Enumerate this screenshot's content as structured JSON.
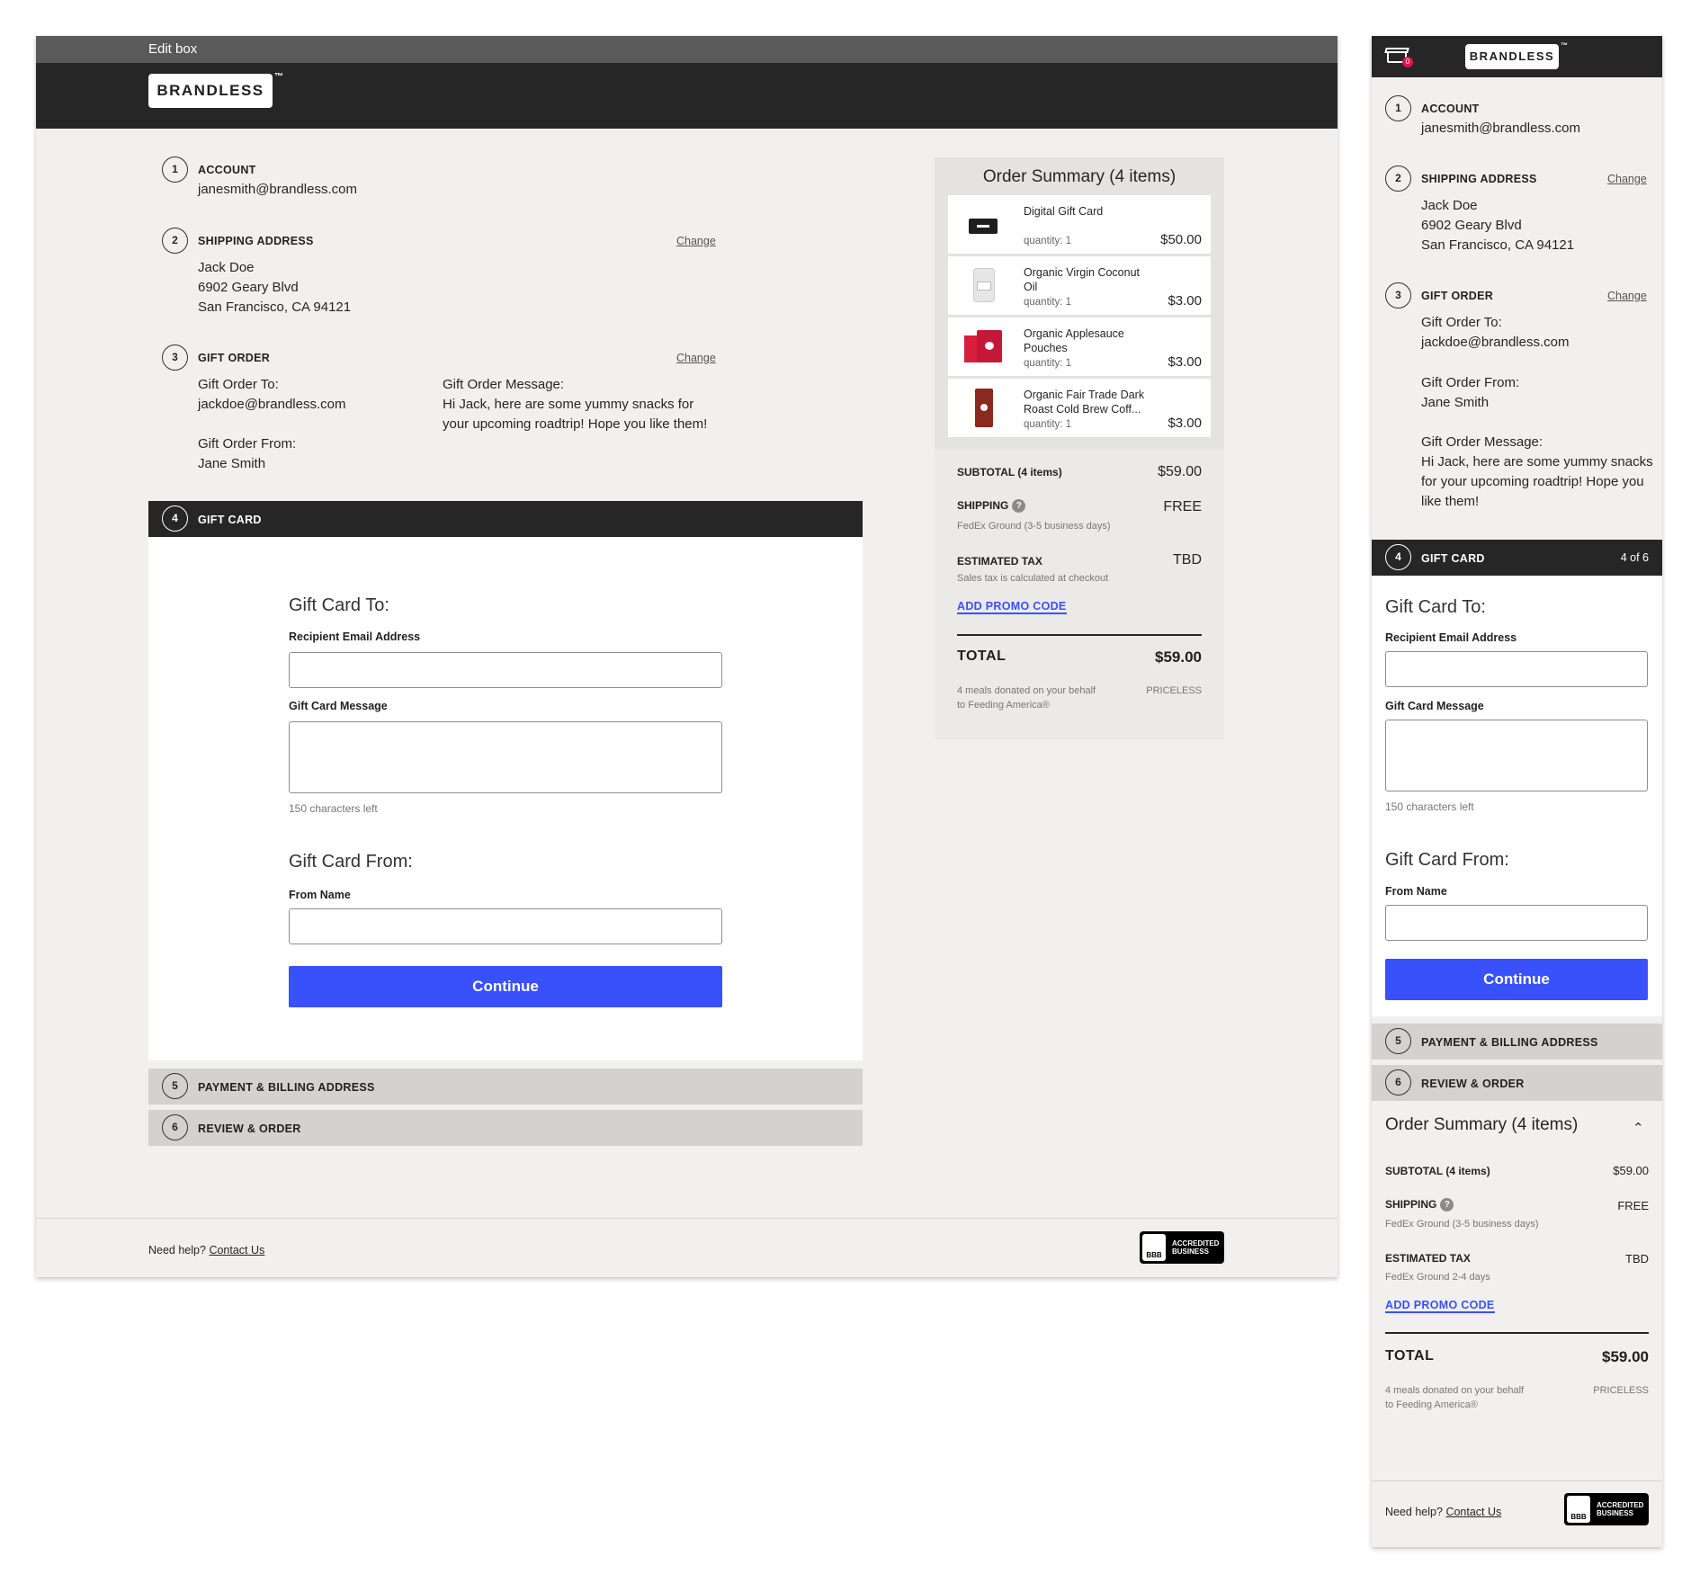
{
  "brand": {
    "logo": "BRANDLESS",
    "tm": "™"
  },
  "editor_bar": {
    "label": "Edit box"
  },
  "steps": {
    "account": {
      "num": "1",
      "title": "ACCOUNT",
      "email": "janesmith@brandless.com"
    },
    "shipping": {
      "num": "2",
      "title": "SHIPPING ADDRESS",
      "change": "Change",
      "line1": "Jack Doe",
      "line2": "6902 Geary Blvd",
      "line3": "San Francisco, CA 94121"
    },
    "gift_order": {
      "num": "3",
      "title": "GIFT ORDER",
      "change": "Change",
      "to_label": "Gift Order To:",
      "to_value": "jackdoe@brandless.com",
      "from_label": "Gift Order From:",
      "from_value": "Jane Smith",
      "message_label": "Gift Order Message:",
      "message_line1": "Hi Jack, here are some yummy snacks for",
      "message_line2": "your upcoming roadtrip! Hope you like them!"
    },
    "gift_card": {
      "num": "4",
      "title": "GIFT CARD",
      "progress": "4 of 6"
    },
    "payment": {
      "num": "5",
      "title": "PAYMENT & BILLING ADDRESS"
    },
    "review": {
      "num": "6",
      "title": "REVIEW & ORDER"
    }
  },
  "gift_card_form": {
    "to_heading": "Gift Card To:",
    "email_label": "Recipient Email Address",
    "email_value": "",
    "message_label": "Gift Card Message",
    "message_value": "",
    "chars_left": "150 characters left",
    "from_heading": "Gift Card From:",
    "from_label": "From Name",
    "from_value": "",
    "continue": "Continue"
  },
  "summary": {
    "title": "Order Summary (4 items)",
    "items": [
      {
        "name": "Digital Gift Card",
        "name2": "",
        "qty": "quantity: 1",
        "price": "$50.00"
      },
      {
        "name": "Organic Virgin Coconut",
        "name2": "Oil",
        "qty": "quantity: 1",
        "price": "$3.00"
      },
      {
        "name": "Organic Applesauce",
        "name2": "Pouches",
        "qty": "quantity: 1",
        "price": "$3.00"
      },
      {
        "name": "Organic Fair Trade Dark",
        "name2": "Roast Cold Brew Coff...",
        "qty": "quantity: 1",
        "price": "$3.00"
      }
    ],
    "subtotal_label": "SUBTOTAL (4 items)",
    "subtotal_value": "$59.00",
    "shipping_label": "SHIPPING",
    "shipping_value": "FREE",
    "shipping_sub": "FedEx Ground (3-5 business days)",
    "tax_label": "ESTIMATED TAX",
    "tax_value": "TBD",
    "tax_sub": "Sales tax is calculated at checkout",
    "tax_sub_mobile": "FedEx Ground 2-4 days",
    "promo": "ADD PROMO CODE",
    "total_label": "TOTAL",
    "total_value": "$59.00",
    "donate_line1": "4 meals donated on your behalf",
    "donate_line2": "to Feeding America®",
    "priceless": "PRICELESS"
  },
  "footer": {
    "help": "Need help?",
    "contact": "Contact Us",
    "bbb_line1": "ACCREDITED",
    "bbb_line2": "BUSINESS",
    "bbb_seal": "BBB"
  },
  "mobile": {
    "cart_count": "0"
  },
  "colors": {
    "accent": "#3951fb",
    "dark": "#262626",
    "panel_grey": "#d3d2d1",
    "background": "#f1f0ef"
  }
}
